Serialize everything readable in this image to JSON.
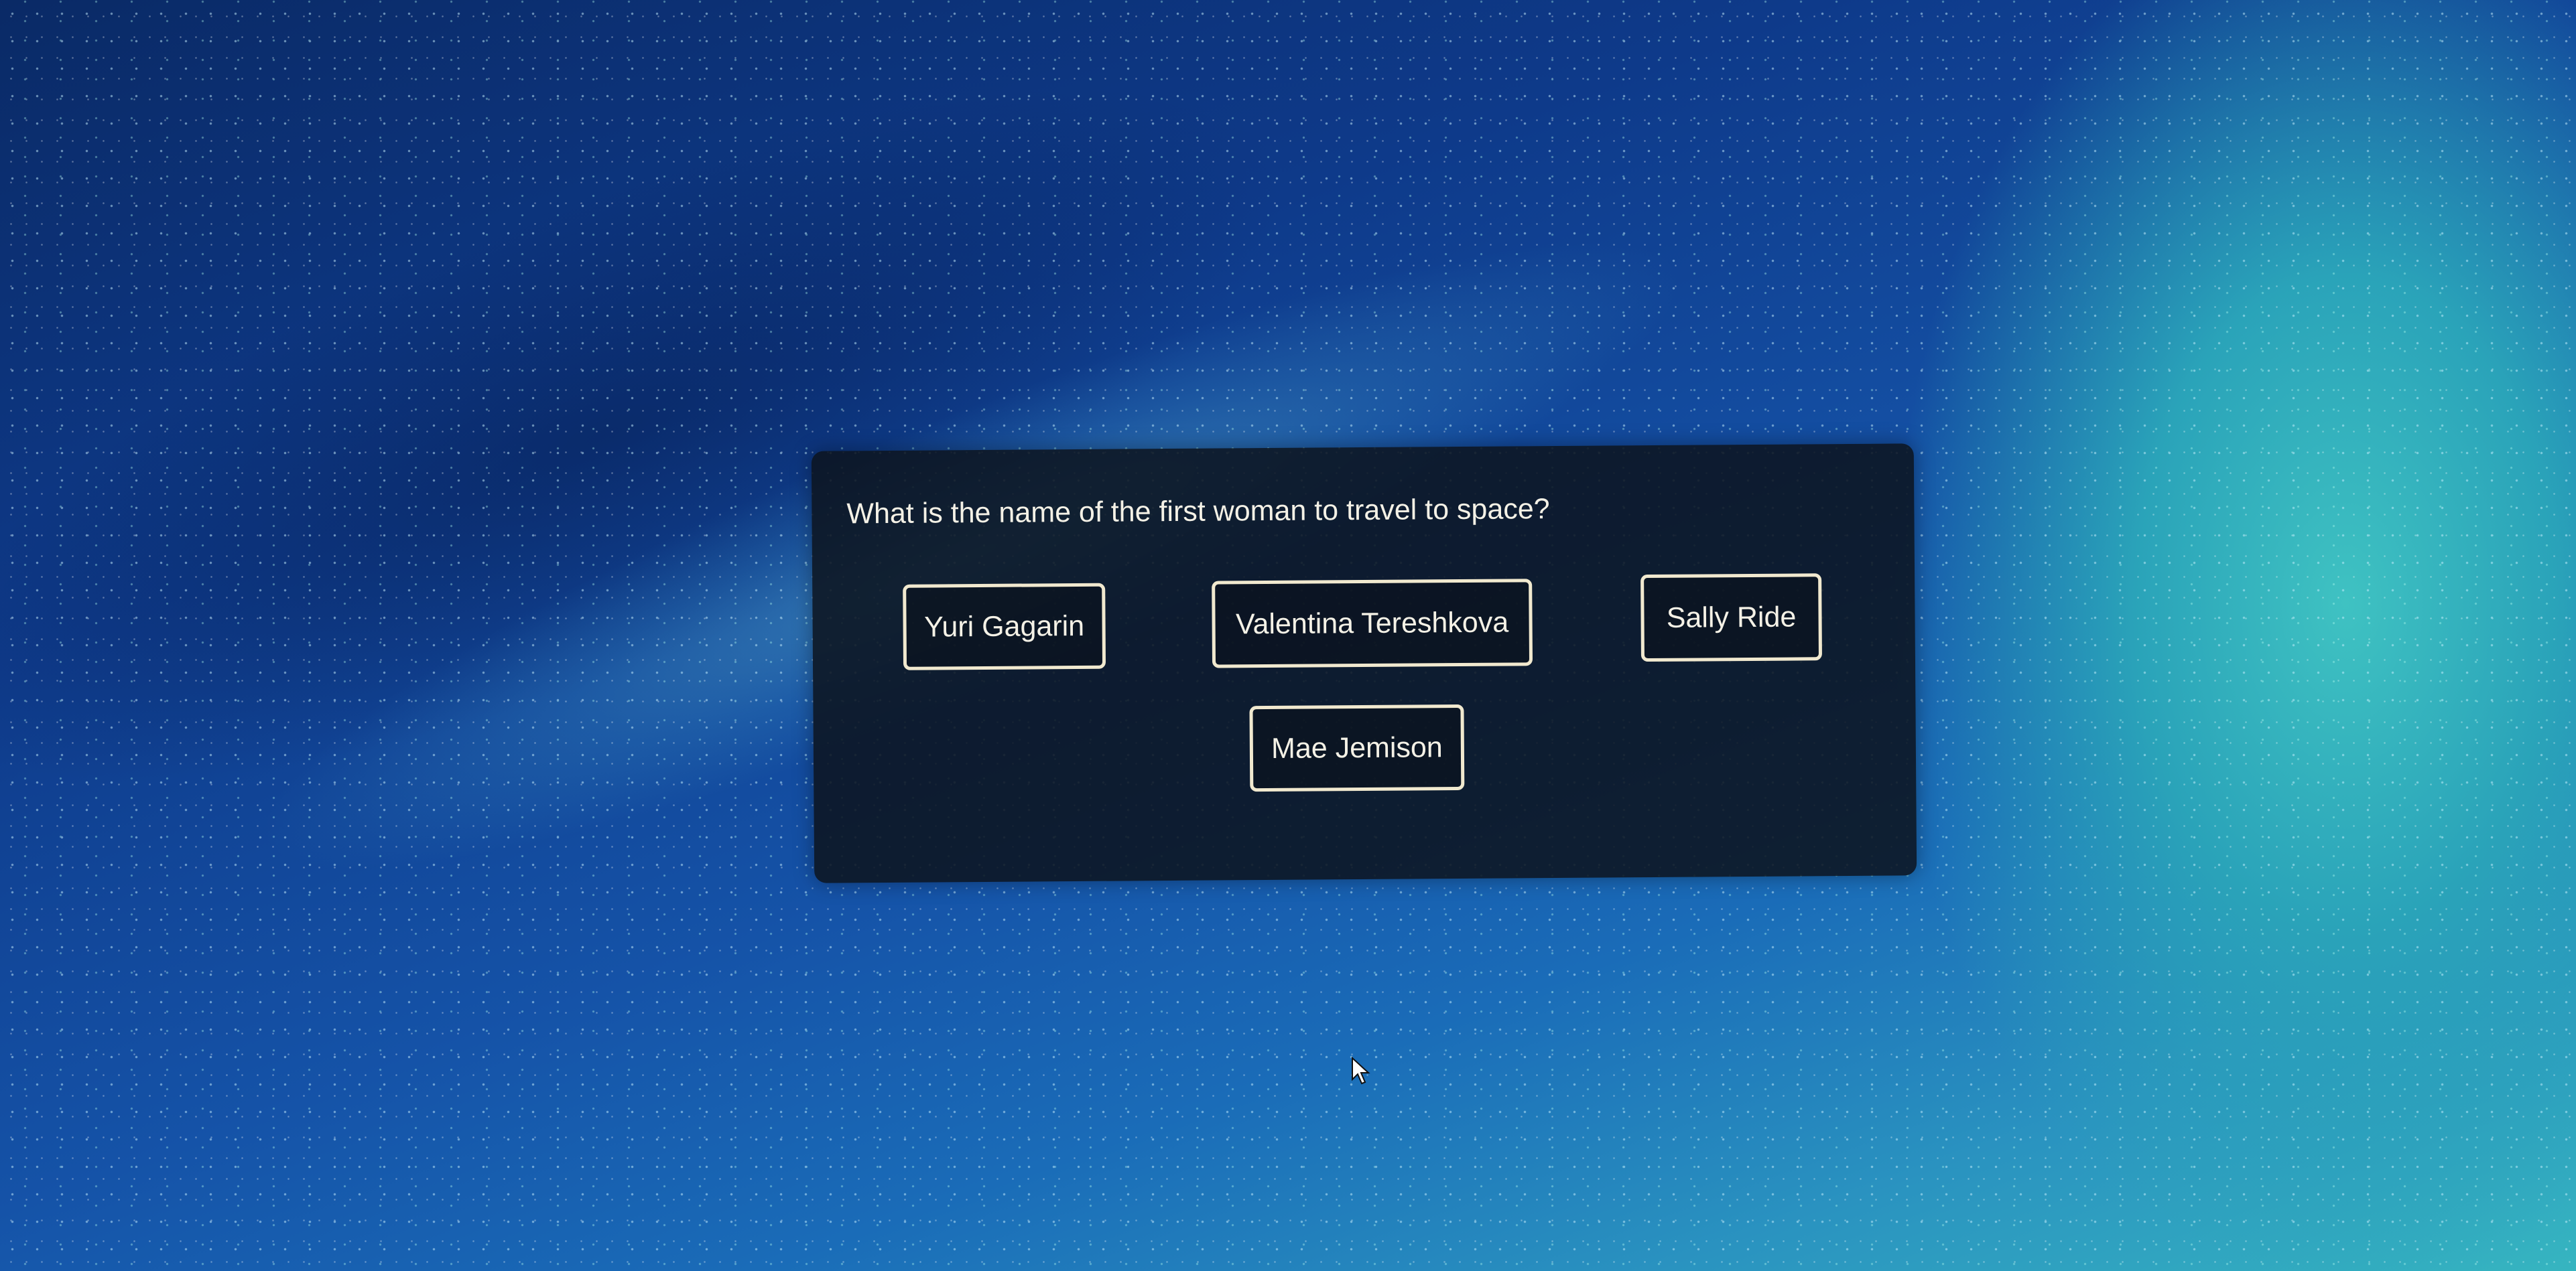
{
  "quiz": {
    "question": "What is the name of the first woman to travel to space?",
    "answers": [
      {
        "label": "Yuri Gagarin"
      },
      {
        "label": "Valentina Tereshkova"
      },
      {
        "label": "Sally Ride"
      },
      {
        "label": "Mae Jemison"
      }
    ]
  },
  "colors": {
    "background": "#0e3a8a",
    "card": "#0c1420",
    "text": "#f4f1e6",
    "button_border": "#f1e9cf",
    "accent_glow": "#3fc2c2"
  },
  "icons": {
    "cursor": "pointer-cursor-icon"
  }
}
